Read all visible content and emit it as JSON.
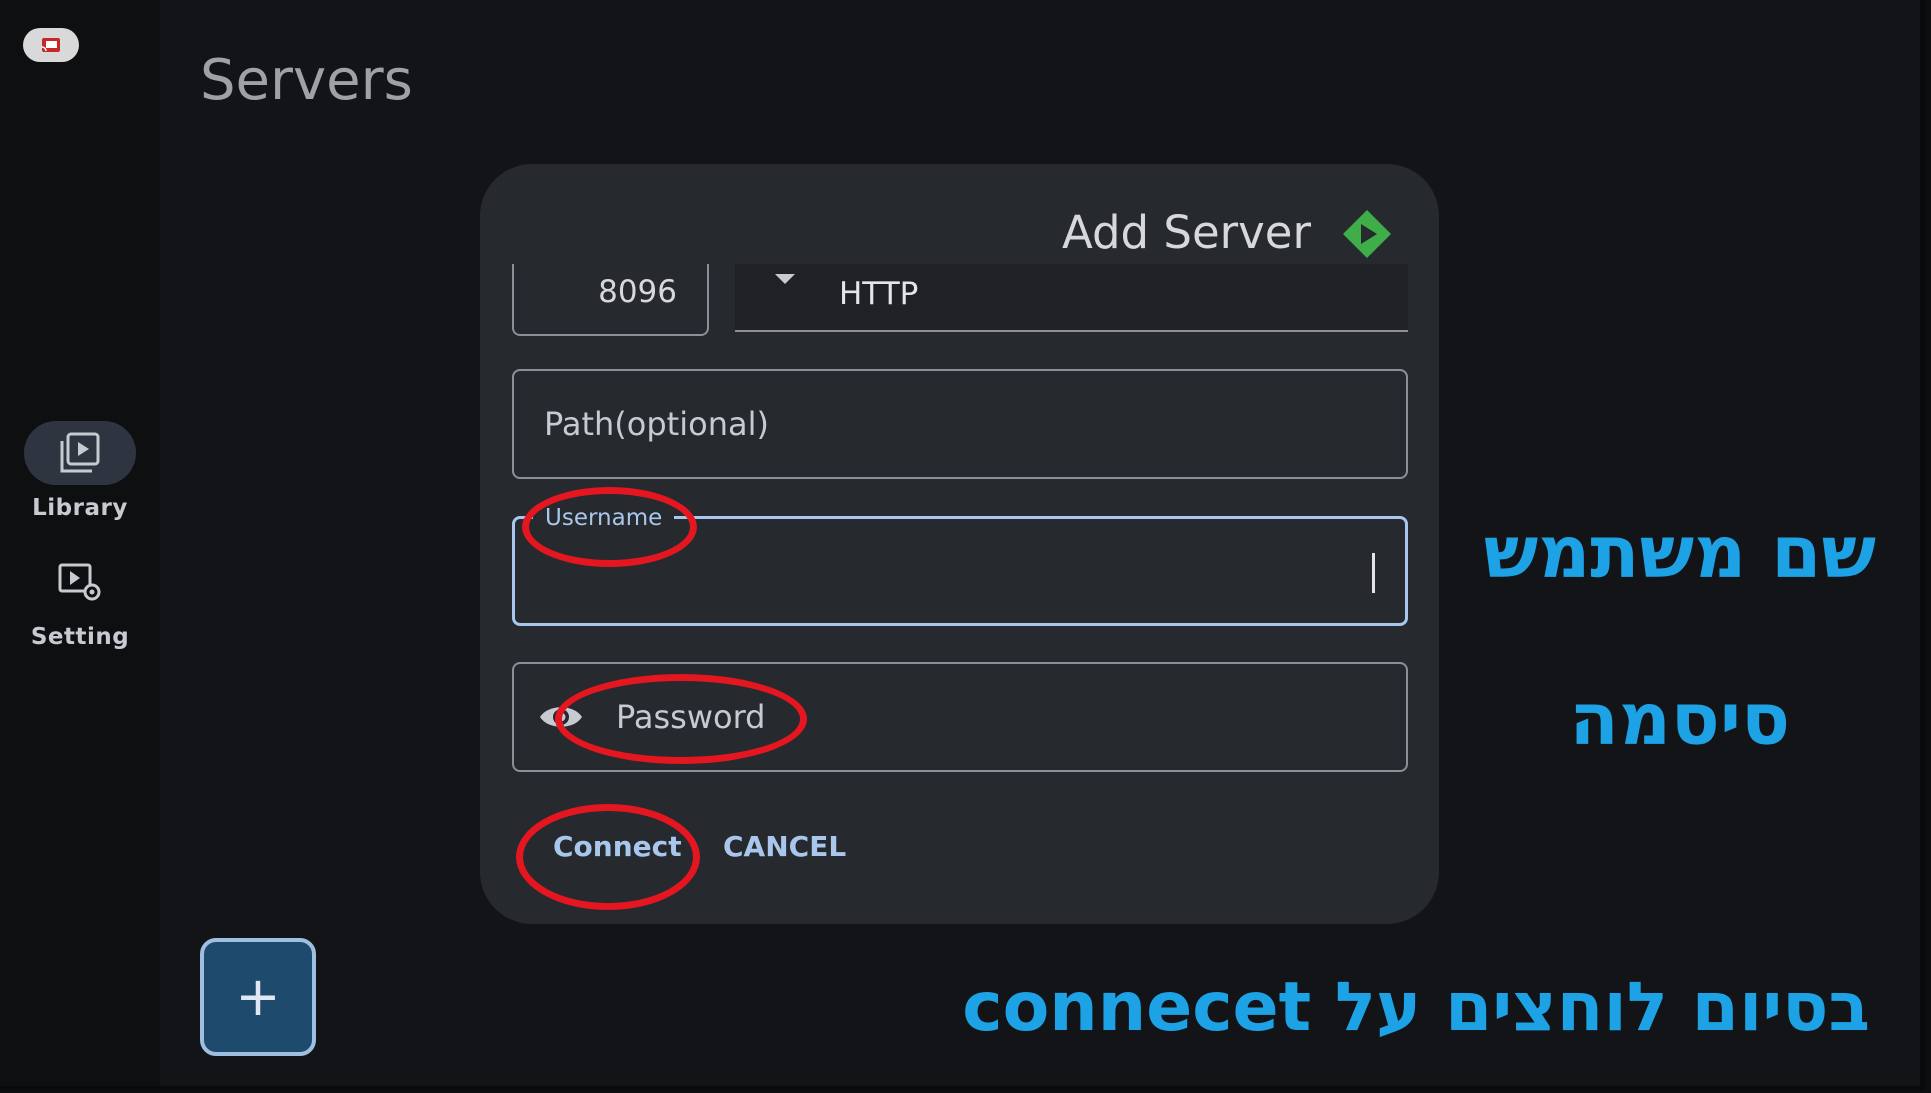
{
  "page": {
    "title": "Servers"
  },
  "sidebar": {
    "items": [
      {
        "label": "Library",
        "icon": "video-library-icon",
        "active": true
      },
      {
        "label": "Setting",
        "icon": "video-settings-icon",
        "active": false
      }
    ],
    "cast_icon": "cast-icon"
  },
  "dialog": {
    "title": "Add Server",
    "port": "8096",
    "scheme": "HTTP",
    "path_placeholder": "Path(optional)",
    "username_label": "Username",
    "password_placeholder": "Password",
    "connect_label": "Connect",
    "cancel_label": "CANCEL"
  },
  "fab": {
    "label": "+"
  },
  "annotations": {
    "username_hint": "שם משתמש",
    "password_hint": "סיסמה",
    "finish_hint": "בסיום לוחצים על connecet"
  },
  "colors": {
    "accent": "#a9c7ec",
    "annotation_ring": "#e4161f",
    "annotation_text": "#1ea2e6",
    "logo_green": "#3fae49"
  }
}
